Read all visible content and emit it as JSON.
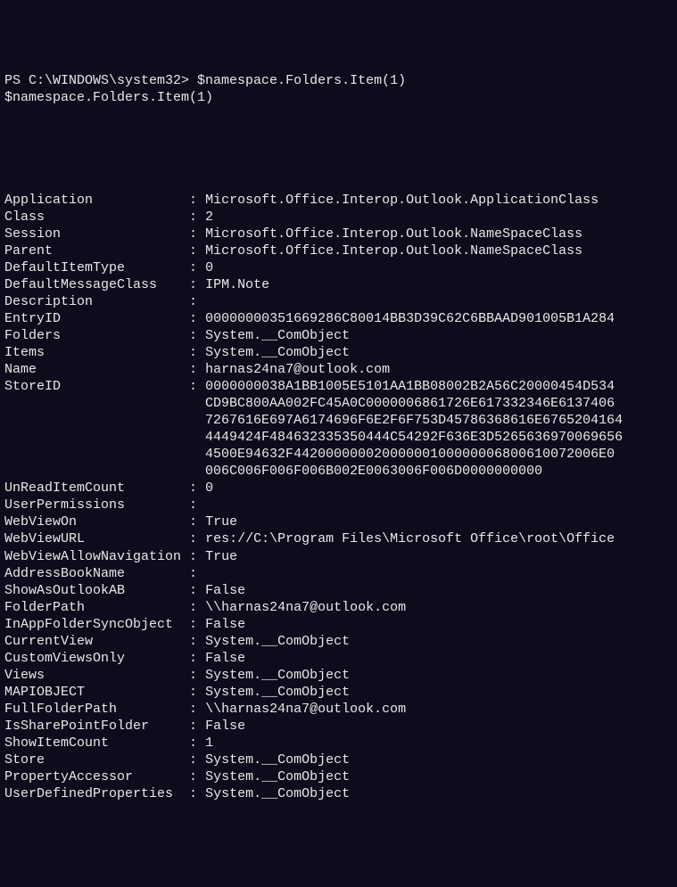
{
  "prompt": "PS C:\\WINDOWS\\system32> ",
  "command": "$namespace.Folders.Item(1)",
  "echo": "$namespace.Folders.Item(1)",
  "properties": [
    {
      "name": "Application",
      "value": "Microsoft.Office.Interop.Outlook.ApplicationClass"
    },
    {
      "name": "Class",
      "value": "2"
    },
    {
      "name": "Session",
      "value": "Microsoft.Office.Interop.Outlook.NameSpaceClass"
    },
    {
      "name": "Parent",
      "value": "Microsoft.Office.Interop.Outlook.NameSpaceClass"
    },
    {
      "name": "DefaultItemType",
      "value": "0"
    },
    {
      "name": "DefaultMessageClass",
      "value": "IPM.Note"
    },
    {
      "name": "Description",
      "value": ""
    },
    {
      "name": "EntryID",
      "value": "00000000351669286C80014BB3D39C62C6BBAAD901005B1A284"
    },
    {
      "name": "Folders",
      "value": "System.__ComObject"
    },
    {
      "name": "Items",
      "value": "System.__ComObject"
    },
    {
      "name": "Name",
      "value": "harnas24na7@outlook.com"
    },
    {
      "name": "StoreID",
      "value": "0000000038A1BB1005E5101AA1BB08002B2A56C20000454D534",
      "continuation": [
        "CD9BC800AA002FC45A0C0000006861726E617332346E6137406",
        "7267616E697A6174696F6E2F6F753D45786368616E6765204164",
        "4449424F484632335350444C54292F636E3D5265636970069656",
        "4500E94632F44200000002000000100000006800610072006E0",
        "006C006F006F006B002E0063006F006D0000000000"
      ]
    },
    {
      "name": "UnReadItemCount",
      "value": "0"
    },
    {
      "name": "UserPermissions",
      "value": ""
    },
    {
      "name": "WebViewOn",
      "value": "True"
    },
    {
      "name": "WebViewURL",
      "value": "res://C:\\Program Files\\Microsoft Office\\root\\Office"
    },
    {
      "name": "WebViewAllowNavigation",
      "value": "True"
    },
    {
      "name": "AddressBookName",
      "value": ""
    },
    {
      "name": "ShowAsOutlookAB",
      "value": "False"
    },
    {
      "name": "FolderPath",
      "value": "\\\\harnas24na7@outlook.com"
    },
    {
      "name": "InAppFolderSyncObject",
      "value": "False"
    },
    {
      "name": "CurrentView",
      "value": "System.__ComObject"
    },
    {
      "name": "CustomViewsOnly",
      "value": "False"
    },
    {
      "name": "Views",
      "value": "System.__ComObject"
    },
    {
      "name": "MAPIOBJECT",
      "value": "System.__ComObject"
    },
    {
      "name": "FullFolderPath",
      "value": "\\\\harnas24na7@outlook.com"
    },
    {
      "name": "IsSharePointFolder",
      "value": "False"
    },
    {
      "name": "ShowItemCount",
      "value": "1"
    },
    {
      "name": "Store",
      "value": "System.__ComObject"
    },
    {
      "name": "PropertyAccessor",
      "value": "System.__ComObject"
    },
    {
      "name": "UserDefinedProperties",
      "value": "System.__ComObject"
    }
  ],
  "nameColumnWidth": 23
}
